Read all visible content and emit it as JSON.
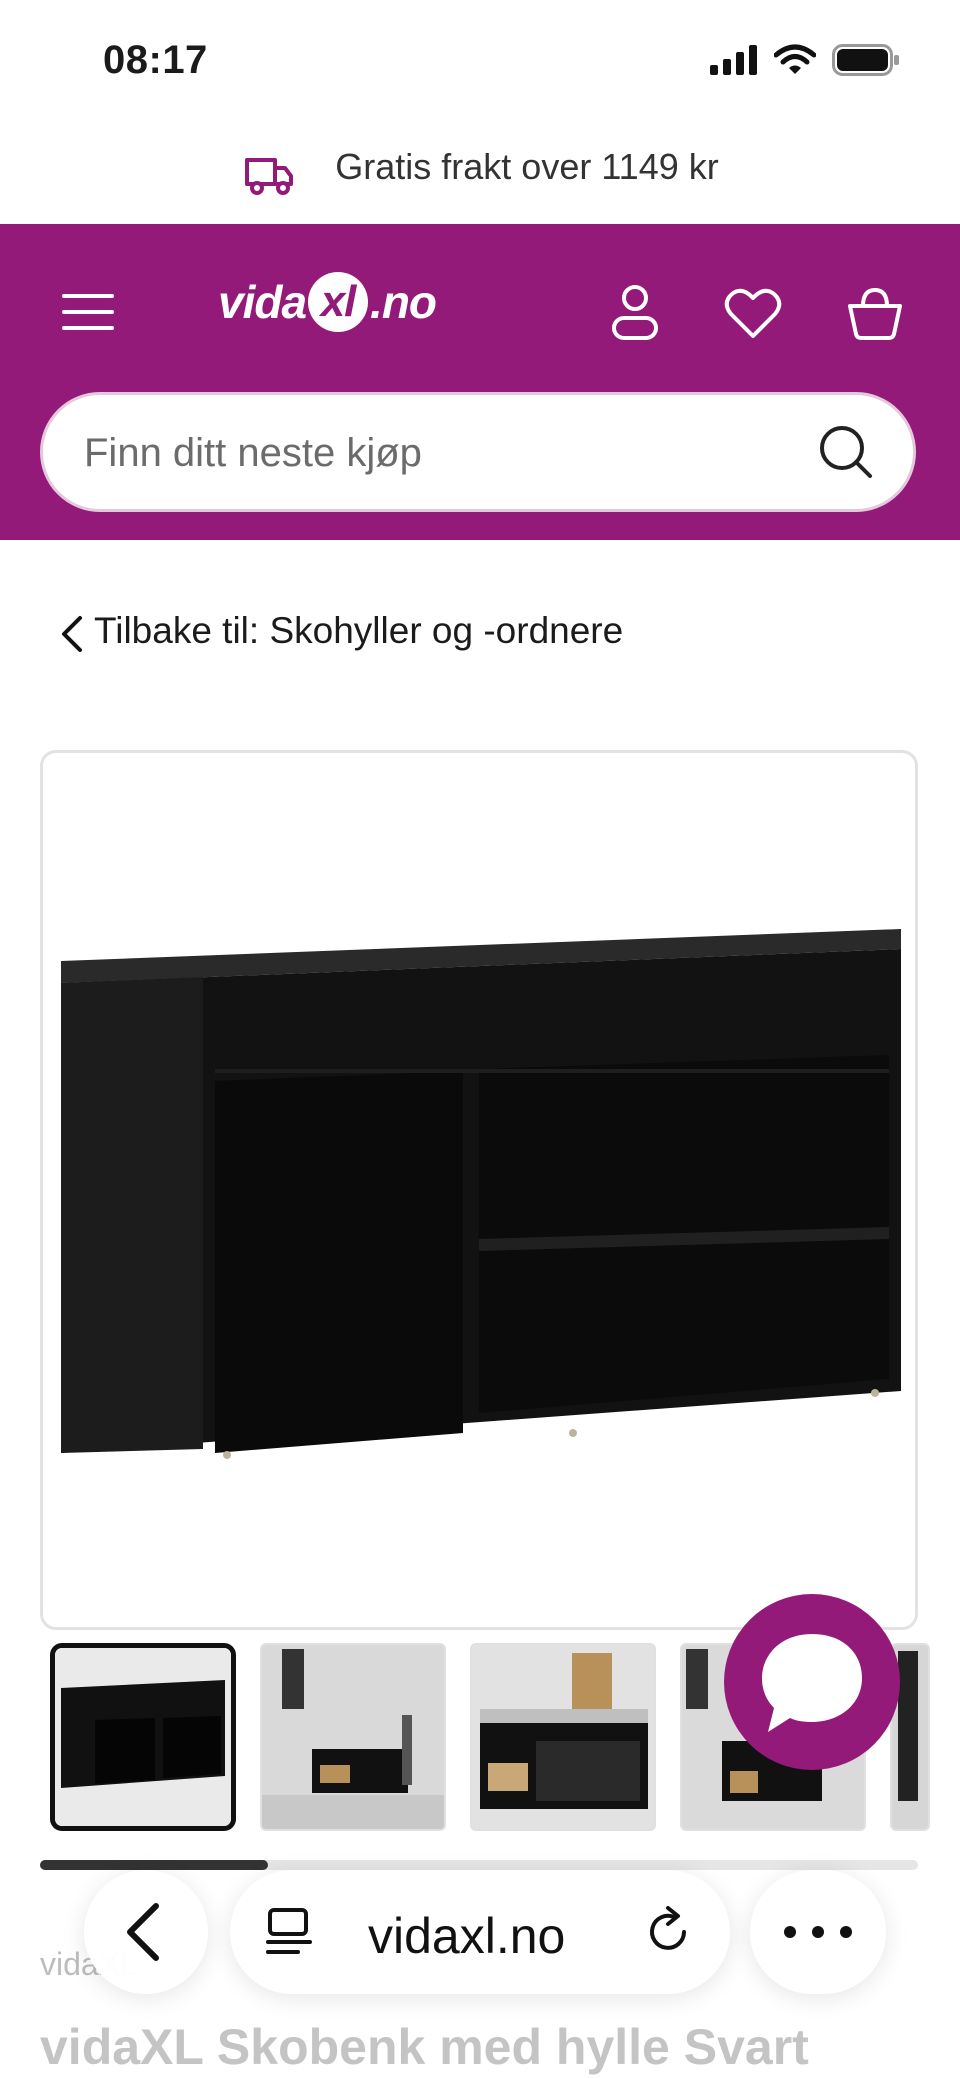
{
  "status_bar": {
    "time": "08:17"
  },
  "shipping_banner": {
    "text": "Gratis frakt over 1149 kr"
  },
  "header": {
    "logo_left": "vida",
    "logo_xl": "xl",
    "logo_right": ".no",
    "search": {
      "placeholder": "Finn ditt neste kjøp"
    },
    "colors": {
      "brand": "#931a78"
    }
  },
  "breadcrumb": {
    "back_label": "Tilbake til: Skohyller og -ordnere"
  },
  "gallery": {
    "thumbnail_count_visible": 4,
    "progress_fraction": 0.26
  },
  "product": {
    "brand": "vidaXL",
    "title": "vidaXL Skobenk med hylle Svart"
  },
  "browser": {
    "url": "vidaxl.no"
  }
}
